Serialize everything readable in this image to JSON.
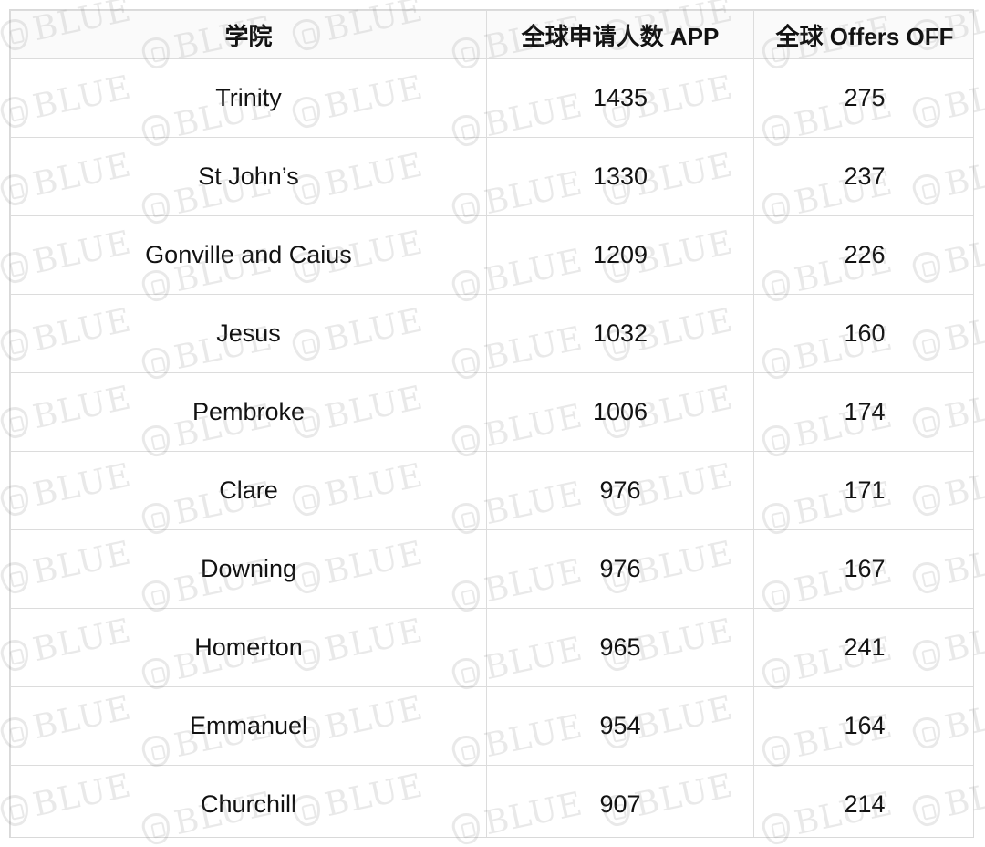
{
  "table": {
    "headers": [
      "学院",
      "全球申请人数 APP",
      "全球 Offers OFF"
    ],
    "rows": [
      {
        "college": "Trinity",
        "app": "1435",
        "off": "275"
      },
      {
        "college": "St John’s",
        "app": "1330",
        "off": "237"
      },
      {
        "college": "Gonville and Caius",
        "app": "1209",
        "off": "226"
      },
      {
        "college": "Jesus",
        "app": "1032",
        "off": "160"
      },
      {
        "college": "Pembroke",
        "app": "1006",
        "off": "174"
      },
      {
        "college": "Clare",
        "app": "976",
        "off": "171"
      },
      {
        "college": "Downing",
        "app": "976",
        "off": "167"
      },
      {
        "college": "Homerton",
        "app": "965",
        "off": "241"
      },
      {
        "college": "Emmanuel",
        "app": "954",
        "off": "164"
      },
      {
        "college": "Churchill",
        "app": "907",
        "off": "214"
      }
    ]
  },
  "watermark": {
    "text": "BLUE",
    "icon": "shield-icon",
    "color": "#7a7a7a"
  },
  "colors": {
    "grid": "#dcdcdc",
    "header_bg": "#fafafa",
    "text": "#111111"
  }
}
